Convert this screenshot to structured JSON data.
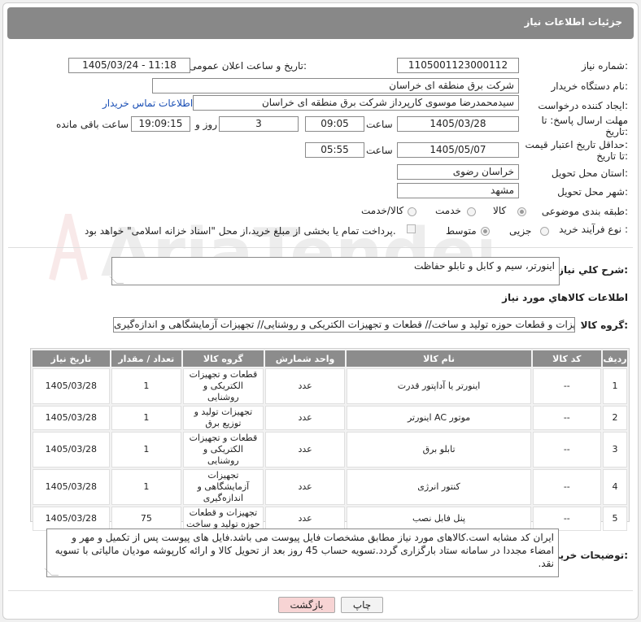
{
  "header": {
    "title": "جزئیات اطلاعات نیاز"
  },
  "fields": {
    "need_number_label": "شماره نیاز:",
    "need_number": "1105001123000112",
    "announce_label": "تاریخ و ساعت اعلان عمومی:",
    "announce_value": "1405/03/24 - 11:18",
    "buyer_org_label": "نام دستگاه خریدار:",
    "buyer_org": "شرکت برق منطقه ای خراسان",
    "creator_label": "ایجاد کننده درخواست:",
    "creator": "سیدمحمدرضا موسوی کارپرداز شرکت برق منطقه ای خراسان",
    "contact_link": "اطلاعات تماس خریدار",
    "deadline_label_1": "مهلت ارسال پاسخ: تا",
    "deadline_label_2": "تاریخ:",
    "deadline_date": "1405/03/28",
    "time_word": "ساعت",
    "deadline_time": "09:05",
    "days_value": "3",
    "days_word": "روز و",
    "remaining_time": "19:09:15",
    "remaining_word": "ساعت باقی مانده",
    "validity_label_1": "حداقل تاریخ اعتبار قیمت:",
    "validity_label_2": "تا تاریخ:",
    "validity_date": "1405/05/07",
    "validity_time": "05:55",
    "province_label": "استان محل تحویل:",
    "province": "خراسان رضوی",
    "city_label": "شهر محل تحویل:",
    "city": "مشهد",
    "category_label": "طبقه بندی موضوعی:",
    "category_options": [
      "کالا",
      "خدمت",
      "کالا/خدمت"
    ],
    "process_label": "نوع فرآیند خرید :",
    "process_options": [
      "جزیی",
      "متوسط"
    ],
    "payment_note": "پرداخت تمام یا بخشی از مبلغ خرید،از محل \"اسناد خزانه اسلامی\" خواهد بود."
  },
  "summary": {
    "label": "شرح کلي نياز:",
    "text": "اینورتر، سیم و کابل و تابلو حفاظت"
  },
  "goods_section": {
    "title": "اطلاعات کالاهاي مورد نياز",
    "group_label": "گروه کالا:",
    "group_value": "تجهیزات تولید و توزیع برق// تجهیزات و قطعات حوزه تولید و ساخت// قطعات و تجهیزات الکتریکی و روشنایی// تجهیزات آزمایشگاهی و اندازه‌گیری"
  },
  "table": {
    "headers": [
      "ردیف",
      "کد کالا",
      "نام کالا",
      "واحد شمارش",
      "گروه کالا",
      "تعداد / مقدار",
      "تاریخ نیاز"
    ],
    "rows": [
      [
        "1",
        "--",
        "اینورتر یا آداپتور قدرت",
        "عدد",
        "قطعات و تجهیزات الکتریکی و روشنایی",
        "1",
        "1405/03/28"
      ],
      [
        "2",
        "--",
        "موتور AC اینورتر",
        "عدد",
        "تجهیزات تولید و توزیع برق",
        "1",
        "1405/03/28"
      ],
      [
        "3",
        "--",
        "تابلو برق",
        "عدد",
        "قطعات و تجهیزات الکتریکی و روشنایی",
        "1",
        "1405/03/28"
      ],
      [
        "4",
        "--",
        "کنتور انرژی",
        "عدد",
        "تجهیزات آزمایشگاهی و اندازه‌گیری",
        "1",
        "1405/03/28"
      ],
      [
        "5",
        "--",
        "پنل فابل نصب",
        "عدد",
        "تجهیزات و قطعات حوزه تولید و ساخت",
        "75",
        "1405/03/28"
      ]
    ]
  },
  "buyer_notes": {
    "label": "توضیحات خریدار:",
    "text": "ایران کد مشابه است.کالاهای مورد نیاز مطابق مشخصات فایل پیوست می باشد.فایل های پیوست پس از تکمیل و مهر و امضاء مجددا در سامانه ستاد بارگزاری گردد.تسویه حساب 45 روز بعد از تحویل کالا و ارائه کارپوشه مودیان مالیاتی با تسویه نقد."
  },
  "buttons": {
    "print": "چاپ",
    "back": "بازگشت"
  },
  "watermark": {
    "brand": "AriaTender.neT"
  },
  "colors": {
    "header_bg": "#888888",
    "link": "#1a4fb5",
    "back_button_bg": "#f7d4d4"
  }
}
